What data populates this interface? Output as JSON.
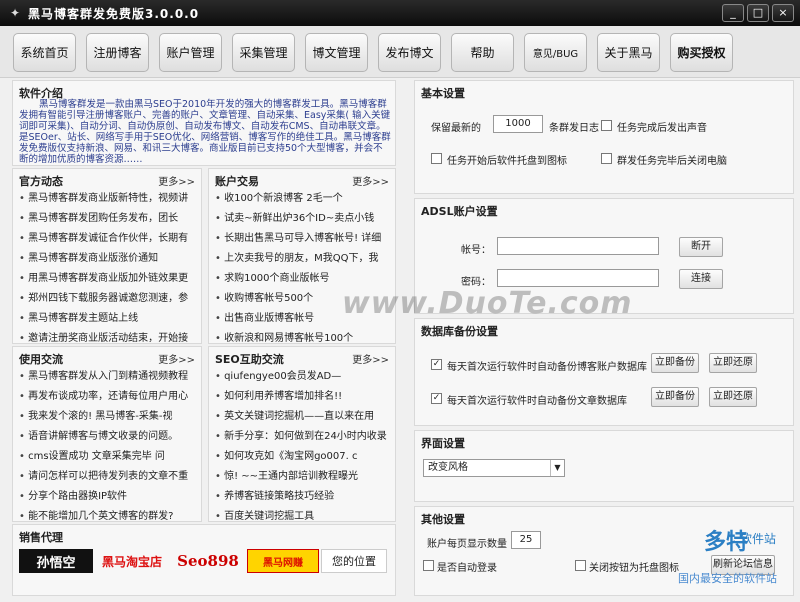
{
  "window": {
    "title": "黑马博客群发免费版3.0.0.0",
    "controls": [
      "_",
      "□",
      "×"
    ]
  },
  "toolbar": {
    "buttons": [
      "系统首页",
      "注册博客",
      "账户管理",
      "采集管理",
      "博文管理",
      "发布博文",
      "帮助",
      "意见/BUG",
      "关于黑马",
      "购买授权"
    ]
  },
  "intro": {
    "title": "软件介绍",
    "text": "黑马博客群发是一款由黑马SEO于2010年开发的强大的博客群发工具。黑马博客群发拥有智能引导注册博客账户、完善的账户、文章管理、自动采集、Easy采集( 输入关键词即可采集)、自动分词、自动伪原创、自动发布博文、自动发布CMS、自动串联文章。是SEOer、站长、网络写手用于SEO优化、网络营销、博客写作的绝佳工具。黑马博客群发免费版仅支持新浪、网易、和讯三大博客。商业版目前已支持50个大型博客，并会不断的增加优质的博客资源……"
  },
  "official_news": {
    "title": "官方动态",
    "more": "更多>>",
    "items": [
      "黑马博客群发商业版新特性，视频讲",
      "黑马博客群发团购任务发布，团长",
      "黑马博客群发诚征合作伙伴，长期有",
      "黑马博客群发商业版涨价通知",
      "用黑马博客群发商业版加外链效果更",
      "郑州四钱下载服务器诚邀您测速，参",
      "黑马博客群发主题站上线",
      "邀请注册奖商业版活动结束，开始接"
    ]
  },
  "account_trade": {
    "title": "账户交易",
    "more": "更多>>",
    "items": [
      "收100个新浪博客 2毛一个",
      "试卖~新鲜出炉36个ID~卖点小钱",
      "长期出售黑马可导入博客帐号! 详细",
      "上次卖我号的朋友，M我QQ下，我",
      "求购1000个商业版帐号",
      "收购博客帐号500个",
      "出售商业版博客帐号",
      "收新浪和网易博客帐号100个"
    ]
  },
  "usage_exchange": {
    "title": "使用交流",
    "more": "更多>>",
    "items": [
      "黑马博客群发从入门到精通视频教程",
      "再发布谈成功率，还请每位用户用心",
      "我来发个滚的! 黑马博客-采集-视",
      "语音讲解博客与博文收录的问题。",
      "cms设置成功 文章采集完毕 问",
      "请问怎样可以把待发列表的文章不重",
      "分享个路由器换IP软件",
      "能不能增加几个英文博客的群发?"
    ]
  },
  "seo_exchange": {
    "title": "SEO互助交流",
    "more": "更多>>",
    "items": [
      "qiufengye00会员发AD—",
      "如何利用养博客增加排名!!",
      "英文关键词挖掘机——直以来在用",
      "新手分享：如何做到在24小时内收录",
      "如何攻克如《淘宝网go007. c",
      "惊! ~~王通内部培训教程曝光",
      "养博客链接策略技巧经验",
      "百度关键词挖掘工具"
    ]
  },
  "agents": {
    "title": "销售代理",
    "logos": [
      "孙悟空",
      "黑马淘宝店",
      "Seo898",
      "黑马网赚",
      "您的位置"
    ]
  },
  "basic_settings": {
    "title": "基本设置",
    "keep_label": "保留最新的",
    "keep_value": "1000",
    "keep_suffix": "条群发日志",
    "sound_label": "任务完成后发出声音",
    "tray_label": "任务开始后软件托盘到图标",
    "shutdown_label": "群发任务完毕后关闭电脑"
  },
  "adsl": {
    "title": "ADSL账户设置",
    "account_label": "帐号：",
    "password_label": "密码：",
    "account_value": "",
    "password_value": "",
    "disconnect": "断开",
    "connect": "连接"
  },
  "backup": {
    "title": "数据库备份设置",
    "row1_label": "每天首次运行软件时自动备份博客账户数据库",
    "row2_label": "每天首次运行软件时自动备份文章数据库",
    "backup_now": "立即备份",
    "restore_now": "立即还原"
  },
  "ui_settings": {
    "title": "界面设置",
    "style_value": "改变风格"
  },
  "other": {
    "title": "其他设置",
    "page_label": "账户每页显示数量",
    "page_value": "25",
    "autologin_label": "是否自动登录",
    "tray_close_label": "关闭按钮为托盘图标",
    "refresh_label": "刷新论坛信息"
  },
  "watermarks": {
    "duote": "www.DuoTe.com",
    "logo_main": "多特",
    "logo_tag": "软件站",
    "logo_sub": "国内最安全的软件站"
  }
}
